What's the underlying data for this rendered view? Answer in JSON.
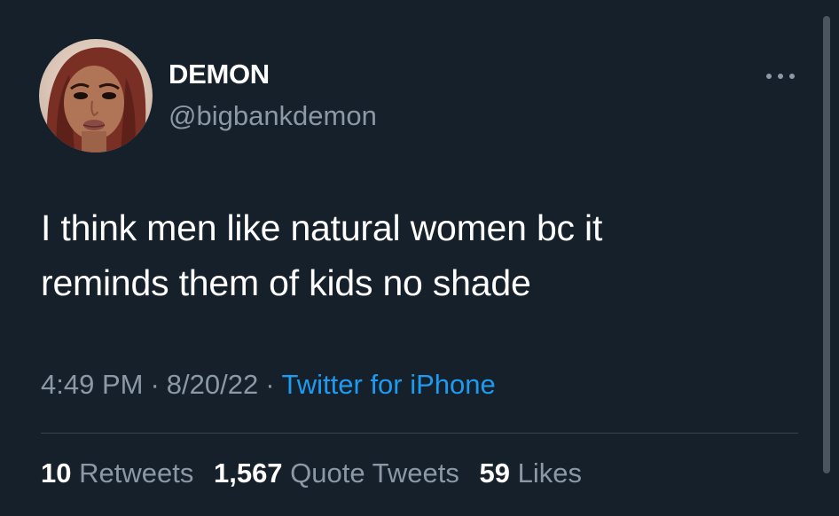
{
  "tweet": {
    "author": {
      "display_name": "DEMON",
      "handle": "@bigbankdemon",
      "avatar_icon": "profile-photo"
    },
    "more_icon": "ellipsis-icon",
    "text_line1": "I think men like natural women bc it",
    "text_line2": "reminds them of kids no shade",
    "time": "4:49 PM",
    "date": "8/20/22",
    "separator": "·",
    "source": "Twitter for iPhone",
    "stats": {
      "retweets_count": "10",
      "retweets_label": "Retweets",
      "quote_tweets_count": "1,567",
      "quote_tweets_label": "Quote Tweets",
      "likes_count": "59",
      "likes_label": "Likes"
    }
  },
  "colors": {
    "background": "#15202b",
    "primary_text": "#ffffff",
    "secondary_text": "#8b98a5",
    "link": "#1d9bf0",
    "divider": "#38444d"
  }
}
